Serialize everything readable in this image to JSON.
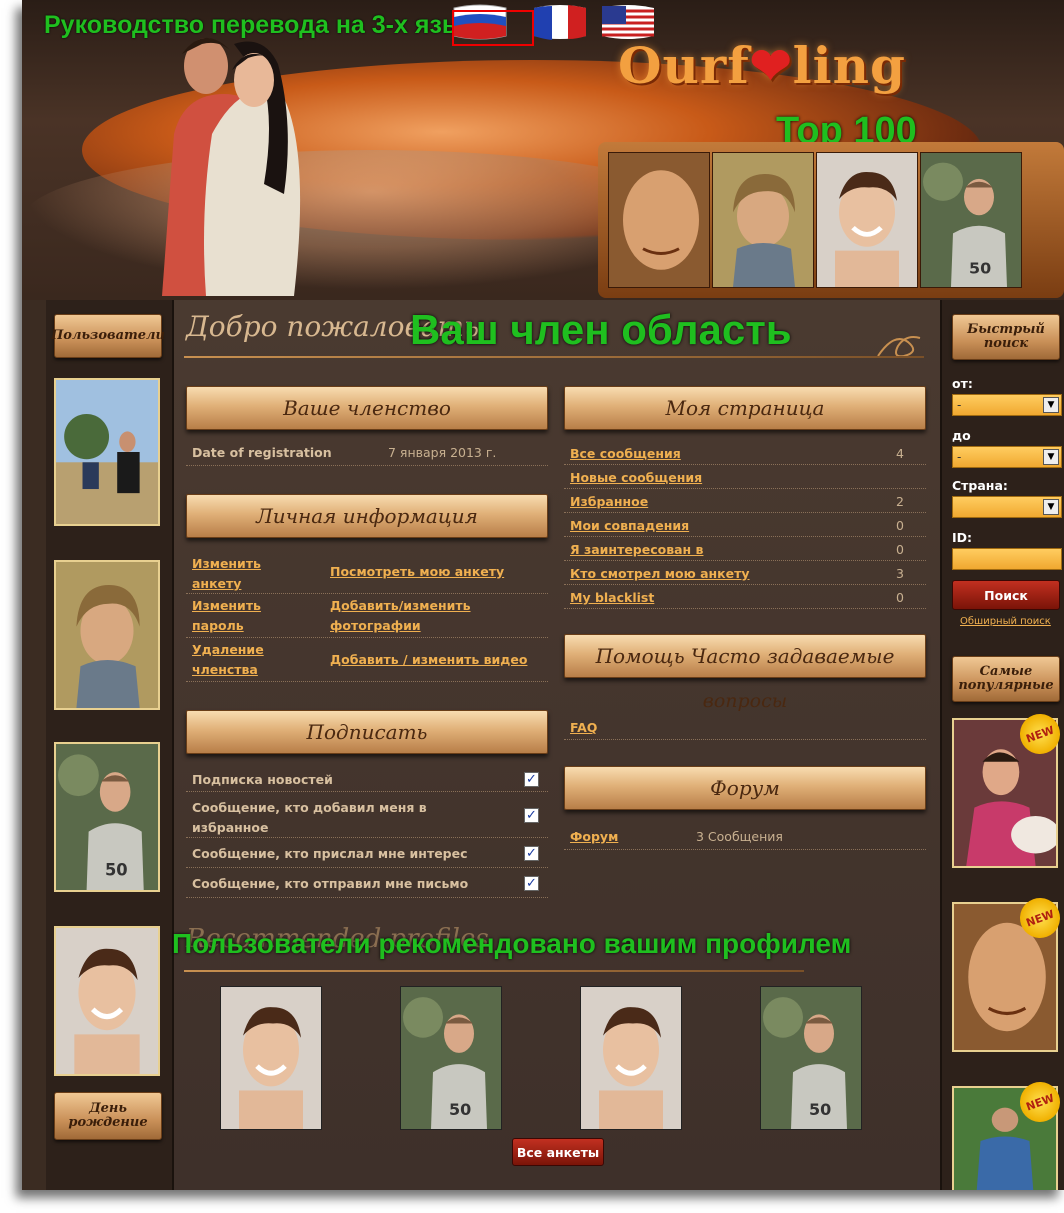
{
  "overlay": {
    "guide_title": "Руководство перевода на 3-х языках",
    "top100": "Top 100",
    "member_area": "Ваш член область",
    "recommended": "Пользователи рекомендовано вашим профилем"
  },
  "header": {
    "logo_left": "Ourf",
    "logo_right": "ling"
  },
  "flags": [
    "flag-russia-icon",
    "flag-france-icon",
    "flag-usa-icon"
  ],
  "left_sidebar": {
    "users_label": "Пользователи",
    "birthday_label": "День рождение"
  },
  "main": {
    "welcome": "Добро пожаловать",
    "membership": {
      "title": "Ваше членство",
      "reg_label": "Date of registration",
      "reg_value": "7 января 2013 г."
    },
    "personal": {
      "title": "Личная информация",
      "links": [
        "Изменить анкету",
        "Посмотреть мою анкету",
        "Изменить пароль",
        "Добавить/изменить фотографии",
        "Удаление членства",
        "Добавить / изменить видео"
      ]
    },
    "subscribe": {
      "title": "Подписать",
      "items": [
        "Подписка новостей",
        "Сообщение, кто добавил меня в избранное",
        "Сообщение, кто прислал мне интерес",
        "Сообщение, кто отправил мне письмо"
      ]
    },
    "mypage": {
      "title": "Моя страница",
      "items": [
        {
          "label": "Все сообщения",
          "count": "4"
        },
        {
          "label": "Новые сообщения",
          "count": ""
        },
        {
          "label": "Избранное",
          "count": "2"
        },
        {
          "label": "Мои совпадения",
          "count": "0"
        },
        {
          "label": "Я заинтересован в",
          "count": "0"
        },
        {
          "label": "Кто смотрел мою анкету",
          "count": "3"
        },
        {
          "label": "My blacklist",
          "count": "0"
        }
      ]
    },
    "help": {
      "title_line1": "Помощь Часто задаваемые",
      "title_line2": "вопросы",
      "faq": "FAQ"
    },
    "forum": {
      "title": "Форум",
      "link": "Форум",
      "count": "3 Сообщения"
    },
    "recommended_heading": "Recommended profiles",
    "all_profiles_btn": "Все анкеты"
  },
  "right_sidebar": {
    "quick_search": "Быстрый поиск",
    "from_label": "от:",
    "to_label": "до",
    "country_label": "Страна:",
    "id_label": "ID:",
    "select_placeholder": "-",
    "search_btn": "Поиск",
    "advanced_search": "Обширный поиск",
    "most_popular": "Самые популярные",
    "new_badge": "NEW"
  }
}
